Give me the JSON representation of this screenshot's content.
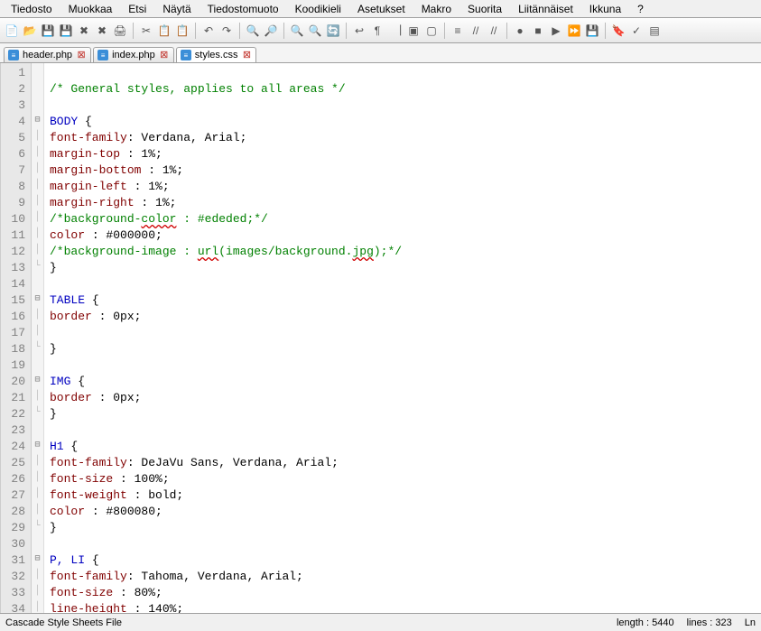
{
  "menu": [
    "Tiedosto",
    "Muokkaa",
    "Etsi",
    "Näytä",
    "Tiedostomuoto",
    "Koodikieli",
    "Asetukset",
    "Makro",
    "Suorita",
    "Liitännäiset",
    "Ikkuna",
    "?"
  ],
  "toolbar_icons": [
    "new-file",
    "open-file",
    "save-file",
    "save-all",
    "close-file",
    "close-all",
    "print",
    "|",
    "cut",
    "copy",
    "paste",
    "|",
    "undo",
    "redo",
    "|",
    "find",
    "replace",
    "|",
    "zoom-in",
    "zoom-out",
    "sync",
    "|",
    "word-wrap",
    "show-all",
    "indent-guide",
    "fold-all",
    "unfold-all",
    "|",
    "hide-lines",
    "comment",
    "uncomment",
    "|",
    "record-macro",
    "stop-macro",
    "play-macro",
    "fast-forward",
    "save-macro",
    "|",
    "bookmark",
    "spellcheck",
    "doc-map"
  ],
  "tabs": [
    {
      "label": "header.php",
      "active": false,
      "closeable": true
    },
    {
      "label": "index.php",
      "active": false,
      "closeable": true
    },
    {
      "label": "styles.css",
      "active": true,
      "closeable": true
    }
  ],
  "code": {
    "lines": [
      {
        "n": 1,
        "fold": "",
        "tokens": []
      },
      {
        "n": 2,
        "fold": "",
        "tokens": [
          {
            "c": "cm",
            "t": "/* General styles, applies to all areas */"
          }
        ]
      },
      {
        "n": 3,
        "fold": "",
        "tokens": []
      },
      {
        "n": 4,
        "fold": "⊟",
        "tokens": [
          {
            "c": "sel",
            "t": "BODY"
          },
          {
            "c": "punc",
            "t": " {"
          }
        ]
      },
      {
        "n": 5,
        "fold": "│",
        "tokens": [
          {
            "c": "prop",
            "t": "font-family"
          },
          {
            "c": "punc",
            "t": ": Verdana, Arial;"
          }
        ]
      },
      {
        "n": 6,
        "fold": "│",
        "tokens": [
          {
            "c": "prop",
            "t": "margin-top"
          },
          {
            "c": "punc",
            "t": " : 1%;"
          }
        ]
      },
      {
        "n": 7,
        "fold": "│",
        "tokens": [
          {
            "c": "prop",
            "t": "margin-bottom"
          },
          {
            "c": "punc",
            "t": " : 1%;"
          }
        ]
      },
      {
        "n": 8,
        "fold": "│",
        "tokens": [
          {
            "c": "prop",
            "t": "margin-left"
          },
          {
            "c": "punc",
            "t": " : 1%;"
          }
        ]
      },
      {
        "n": 9,
        "fold": "│",
        "tokens": [
          {
            "c": "prop",
            "t": "margin-right"
          },
          {
            "c": "punc",
            "t": " : 1%;"
          }
        ]
      },
      {
        "n": 10,
        "fold": "│",
        "tokens": [
          {
            "c": "cm",
            "t": "/*background-"
          },
          {
            "c": "cm squig",
            "t": "color"
          },
          {
            "c": "cm",
            "t": " : #ededed;*/"
          }
        ]
      },
      {
        "n": 11,
        "fold": "│",
        "tokens": [
          {
            "c": "prop",
            "t": "color"
          },
          {
            "c": "punc",
            "t": " : "
          },
          {
            "c": "punc",
            "t": "#000000;"
          }
        ]
      },
      {
        "n": 12,
        "fold": "│",
        "tokens": [
          {
            "c": "cm",
            "t": "/*background-image : "
          },
          {
            "c": "cm squig",
            "t": "url"
          },
          {
            "c": "cm",
            "t": "(images/background."
          },
          {
            "c": "cm squig",
            "t": "jpg"
          },
          {
            "c": "cm",
            "t": ");*/"
          }
        ]
      },
      {
        "n": 13,
        "fold": "└",
        "tokens": [
          {
            "c": "punc",
            "t": "}"
          }
        ]
      },
      {
        "n": 14,
        "fold": "",
        "tokens": []
      },
      {
        "n": 15,
        "fold": "⊟",
        "tokens": [
          {
            "c": "sel",
            "t": "TABLE"
          },
          {
            "c": "punc",
            "t": " {"
          }
        ]
      },
      {
        "n": 16,
        "fold": "│",
        "tokens": [
          {
            "c": "prop",
            "t": "border"
          },
          {
            "c": "punc",
            "t": " : 0px;"
          }
        ]
      },
      {
        "n": 17,
        "fold": "│",
        "tokens": []
      },
      {
        "n": 18,
        "fold": "└",
        "tokens": [
          {
            "c": "punc",
            "t": "}"
          }
        ]
      },
      {
        "n": 19,
        "fold": "",
        "tokens": []
      },
      {
        "n": 20,
        "fold": "⊟",
        "tokens": [
          {
            "c": "sel",
            "t": "IMG"
          },
          {
            "c": "punc",
            "t": " {"
          }
        ]
      },
      {
        "n": 21,
        "fold": "│",
        "tokens": [
          {
            "c": "prop",
            "t": "border"
          },
          {
            "c": "punc",
            "t": " : 0px;"
          }
        ]
      },
      {
        "n": 22,
        "fold": "└",
        "tokens": [
          {
            "c": "punc",
            "t": "}"
          }
        ]
      },
      {
        "n": 23,
        "fold": "",
        "tokens": []
      },
      {
        "n": 24,
        "fold": "⊟",
        "tokens": [
          {
            "c": "sel",
            "t": "H1"
          },
          {
            "c": "punc",
            "t": " {"
          }
        ]
      },
      {
        "n": 25,
        "fold": "│",
        "tokens": [
          {
            "c": "prop",
            "t": "font-family"
          },
          {
            "c": "punc",
            "t": ": DeJaVu Sans, Verdana, Arial;"
          }
        ]
      },
      {
        "n": 26,
        "fold": "│",
        "tokens": [
          {
            "c": "prop",
            "t": "font-size"
          },
          {
            "c": "punc",
            "t": " : 100%;"
          }
        ]
      },
      {
        "n": 27,
        "fold": "│",
        "tokens": [
          {
            "c": "prop",
            "t": "font-weight"
          },
          {
            "c": "punc",
            "t": " : bold;"
          }
        ]
      },
      {
        "n": 28,
        "fold": "│",
        "tokens": [
          {
            "c": "prop",
            "t": "color"
          },
          {
            "c": "punc",
            "t": " : "
          },
          {
            "c": "punc",
            "t": "#800080;"
          }
        ]
      },
      {
        "n": 29,
        "fold": "└",
        "tokens": [
          {
            "c": "punc",
            "t": "}"
          }
        ]
      },
      {
        "n": 30,
        "fold": "",
        "tokens": []
      },
      {
        "n": 31,
        "fold": "⊟",
        "tokens": [
          {
            "c": "sel",
            "t": "P, LI"
          },
          {
            "c": "punc",
            "t": " {"
          }
        ]
      },
      {
        "n": 32,
        "fold": "│",
        "tokens": [
          {
            "c": "prop",
            "t": "font-family"
          },
          {
            "c": "punc",
            "t": ": Tahoma, Verdana, Arial;"
          }
        ]
      },
      {
        "n": 33,
        "fold": "│",
        "tokens": [
          {
            "c": "prop",
            "t": "font-size"
          },
          {
            "c": "punc",
            "t": " : 80%;"
          }
        ]
      },
      {
        "n": 34,
        "fold": "│",
        "tokens": [
          {
            "c": "prop",
            "t": "line-height"
          },
          {
            "c": "punc",
            "t": " : 140%;"
          }
        ]
      }
    ]
  },
  "status": {
    "left": "Cascade Style Sheets File",
    "length_label": "length :",
    "length_value": "5440",
    "lines_label": "lines :",
    "lines_value": "323",
    "ln_label": "Ln"
  },
  "icons": {
    "new-file": "📄",
    "open-file": "📂",
    "save-file": "💾",
    "save-all": "💾",
    "close-file": "✖",
    "close-all": "✖",
    "print": "🖨",
    "cut": "✂",
    "copy": "📋",
    "paste": "📋",
    "undo": "↶",
    "redo": "↷",
    "find": "🔍",
    "replace": "🔎",
    "zoom-in": "🔍",
    "zoom-out": "🔍",
    "sync": "🔄",
    "word-wrap": "↩",
    "show-all": "¶",
    "indent-guide": "⎹",
    "fold-all": "▣",
    "unfold-all": "▢",
    "hide-lines": "≡",
    "comment": "//",
    "uncomment": "//",
    "record-macro": "●",
    "stop-macro": "■",
    "play-macro": "▶",
    "fast-forward": "⏩",
    "save-macro": "💾",
    "bookmark": "🔖",
    "spellcheck": "✓",
    "doc-map": "▤"
  }
}
